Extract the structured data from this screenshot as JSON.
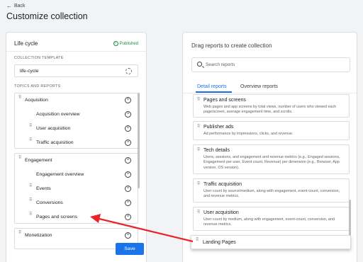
{
  "header": {
    "back_label": "Back",
    "page_title": "Customize collection"
  },
  "left": {
    "collection_name": "Life cycle",
    "status": "Published",
    "template_label": "COLLECTION TEMPLATE",
    "template_value": "life-cycle",
    "topics_label": "TOPICS AND REPORTS",
    "groups": [
      {
        "name": "Acquisition",
        "items": [
          "Acquisition overview",
          "User acquisition",
          "Traffic acquisition"
        ]
      },
      {
        "name": "Engagement",
        "items": [
          "Engagement overview",
          "Events",
          "Conversions",
          "Pages and screens"
        ]
      },
      {
        "name": "Monetization"
      }
    ],
    "save_label": "Save"
  },
  "right": {
    "title": "Drag reports to create collection",
    "search_placeholder": "Search reports",
    "tabs": [
      "Detail reports",
      "Overview reports"
    ],
    "reports": [
      {
        "title": "Pages and screens",
        "desc": "Web pages and app screens by total views, number of users who viewed each page/screen, average engagement time, and scrolls."
      },
      {
        "title": "Publisher ads",
        "desc": "Ad performance by impressions, clicks, and revenue."
      },
      {
        "title": "Tech details",
        "desc": "Users, sessions, and engagement and revenue metrics (e.g., Engaged sessions, Engagement per user, Event count, Revenue) per dimension (e.g., Browser, App version, OS version)."
      },
      {
        "title": "Traffic acquisition",
        "desc": "User count by source/medium, along with engagement, event-count, conversion, and revenue metrics."
      },
      {
        "title": "User acquisition",
        "desc": "User count by medium, along with engagement, event-count, conversion, and revenue metrics."
      }
    ],
    "dragging": "Landing Pages"
  },
  "colors": {
    "accent": "#1a73e8",
    "published": "#1e8e3e",
    "arrow": "#e8232a"
  }
}
